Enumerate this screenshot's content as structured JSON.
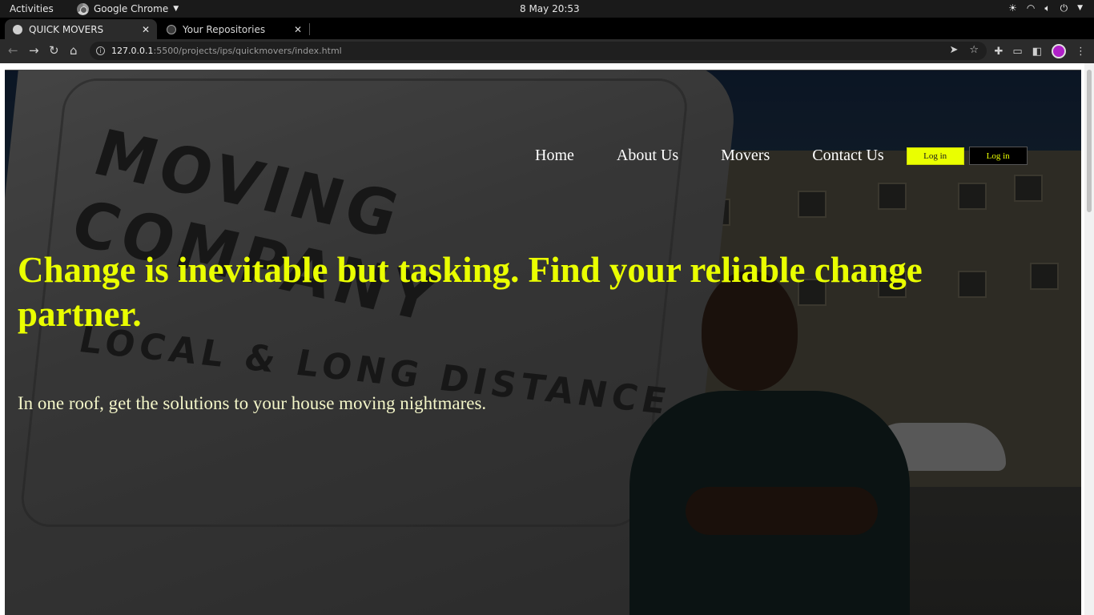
{
  "system_bar": {
    "activities": "Activities",
    "app_name": "Google Chrome",
    "clock": "8 May  20:53"
  },
  "tabs": [
    {
      "title": "QUICK MOVERS"
    },
    {
      "title": "Your Repositories"
    }
  ],
  "address_bar": {
    "host": "127.0.0.1",
    "path": ":5500/projects/ips/quickmovers/index.html"
  },
  "site": {
    "nav": [
      "Home",
      "About Us",
      "Movers",
      "Contact Us"
    ],
    "login_primary": "Log in",
    "login_secondary": "Log in",
    "headline": "Change is inevitable but tasking. Find your reliable change partner.",
    "subheadline": "In one roof, get the solutions to your house moving nightmares.",
    "hero_van_text": [
      "MOVING COMPANY",
      "LOCAL & LONG DISTANCE"
    ]
  },
  "colors": {
    "accent": "#eaff00",
    "browser_dark": "#2b2b2b"
  },
  "icons": {
    "back": "arrow-left-icon",
    "forward": "arrow-right-icon",
    "reload": "reload-icon",
    "home": "home-icon",
    "share": "send-icon",
    "bookmark": "star-icon",
    "extensions": "puzzle-icon",
    "cast": "cast-icon",
    "sidepanel": "sidepanel-icon",
    "menu": "kebab-menu-icon"
  }
}
